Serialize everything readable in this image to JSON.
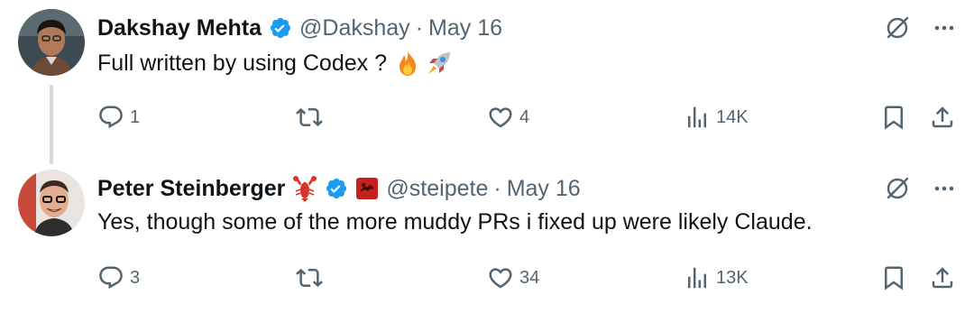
{
  "tweets": [
    {
      "display_name": "Dakshay Mehta",
      "handle": "@Dakshay",
      "date": "May 16",
      "text": "Full written by using Codex ?",
      "text_emojis": [
        "fire-icon",
        "rocket-icon"
      ],
      "verified": true,
      "counts": {
        "replies": "1",
        "retweets": "",
        "likes": "4",
        "views": "14K"
      }
    },
    {
      "display_name": "Peter Steinberger",
      "handle": "@steipete",
      "date": "May 16",
      "text": "Yes, though some of the more muddy PRs i fixed up were likely Claude.",
      "name_emojis": [
        "lobster-icon"
      ],
      "verified": true,
      "affiliate_badge": "red-badge-icon",
      "counts": {
        "replies": "3",
        "retweets": "",
        "likes": "34",
        "views": "13K"
      }
    }
  ],
  "separator": "·",
  "colors": {
    "text": "#0f1419",
    "secondary": "#536471",
    "verified": "#1d9bf0",
    "thread_line": "#cfd9de"
  }
}
